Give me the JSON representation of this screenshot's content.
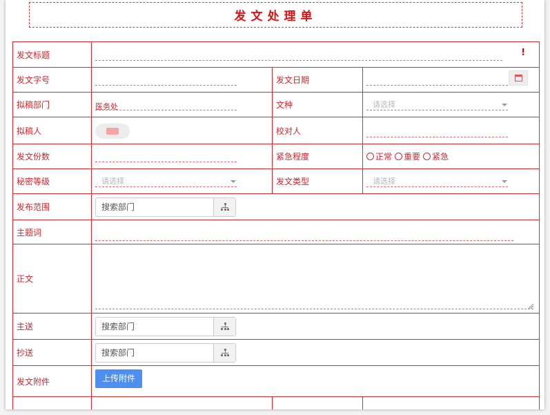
{
  "form": {
    "title": "发文处理单"
  },
  "fields": {
    "title_label": "发文标题",
    "title_required_mark": "!",
    "doc_number_label": "发文字号",
    "issue_date_label": "发文日期",
    "drafting_dept_label": "拟稿部门",
    "drafting_dept_value": "医务处",
    "doc_type_label": "文种",
    "doc_type_placeholder": "请选择",
    "drafter_label": "拟稿人",
    "proofreader_label": "校对人",
    "copies_label": "发文份数",
    "urgency_label": "紧急程度",
    "urgency_options": [
      "正常",
      "重要",
      "紧急"
    ],
    "secrecy_label": "秘密等级",
    "secrecy_placeholder": "请选择",
    "category_label": "发文类型",
    "category_placeholder": "请选择",
    "scope_label": "发布范围",
    "scope_search_placeholder": "搜索部门",
    "keywords_label": "主题词",
    "body_label": "正文",
    "main_recipient_label": "主送",
    "main_recipient_placeholder": "搜索部门",
    "cc_label": "抄送",
    "cc_placeholder": "搜索部门",
    "attachment_label": "发文附件",
    "upload_button": "上传附件"
  },
  "icons": {
    "date": "calendar-icon",
    "dropdown": "chevron-down-icon",
    "org": "org-tree-icon"
  },
  "colors": {
    "accent_red": "#d8232a",
    "button_blue": "#4d8ff1"
  }
}
